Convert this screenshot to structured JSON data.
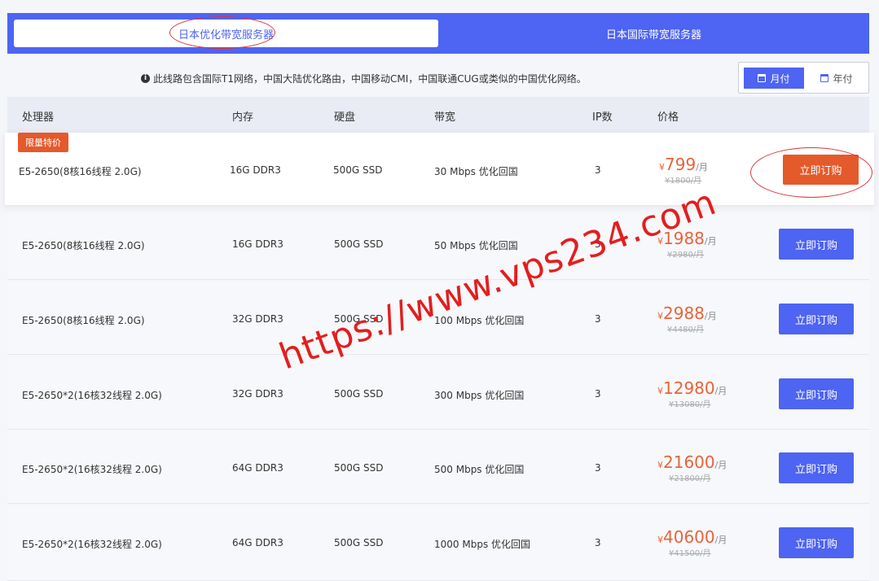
{
  "tabs": [
    {
      "label": "日本优化带宽服务器",
      "active": true
    },
    {
      "label": "日本国际带宽服务器",
      "active": false
    }
  ],
  "notice": "此线路包含国际T1网络，中国大陆优化路由，中国移动CMI，中国联通CUG或类似的中国优化网络。",
  "billing": {
    "month": "月付",
    "year": "年付",
    "selected": "month"
  },
  "columns": {
    "cpu": "处理器",
    "memory": "内存",
    "disk": "硬盘",
    "bandwidth": "带宽",
    "ip": "IP数",
    "price": "价格"
  },
  "currency": "¥",
  "per_unit": "/月",
  "order_label": "立即订购",
  "rows": [
    {
      "badge": "限量特价",
      "cpu": "E5-2650(8核16线程 2.0G)",
      "memory": "16G DDR3",
      "disk": "500G SSD",
      "bandwidth": "30 Mbps 优化回国",
      "ip": "3",
      "price": "799",
      "old_price": "¥1800/月"
    },
    {
      "cpu": "E5-2650(8核16线程 2.0G)",
      "memory": "16G DDR3",
      "disk": "500G SSD",
      "bandwidth": "50 Mbps 优化回国",
      "ip": "3",
      "price": "1988",
      "old_price": "¥2980/月"
    },
    {
      "cpu": "E5-2650(8核16线程 2.0G)",
      "memory": "32G DDR3",
      "disk": "500G SSD",
      "bandwidth": "100 Mbps 优化回国",
      "ip": "3",
      "price": "2988",
      "old_price": "¥4480/月"
    },
    {
      "cpu": "E5-2650*2(16核32线程 2.0G)",
      "memory": "32G DDR3",
      "disk": "500G SSD",
      "bandwidth": "300 Mbps 优化回国",
      "ip": "3",
      "price": "12980",
      "old_price": "¥13080/月"
    },
    {
      "cpu": "E5-2650*2(16核32线程 2.0G)",
      "memory": "64G DDR3",
      "disk": "500G SSD",
      "bandwidth": "500 Mbps 优化回国",
      "ip": "3",
      "price": "21600",
      "old_price": "¥21800/月"
    },
    {
      "cpu": "E5-2650*2(16核32线程 2.0G)",
      "memory": "64G DDR3",
      "disk": "500G SSD",
      "bandwidth": "1000 Mbps 优化回国",
      "ip": "3",
      "price": "40600",
      "old_price": "¥41500/月"
    }
  ],
  "watermark": "https://www.vps234.com",
  "colors": {
    "accent": "#4e64f2",
    "price": "#e8633a",
    "highlight_button": "#e45a2b",
    "annotation": "#d9353a"
  }
}
